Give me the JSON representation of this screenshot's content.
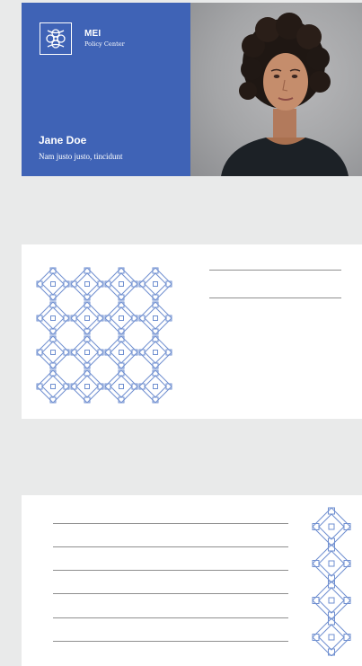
{
  "badge": {
    "brand_name": "MEI",
    "brand_subtitle": "Policy Center",
    "person_name": "Jane Doe",
    "person_title": "Nam justo justo, tincidunt"
  },
  "colors": {
    "background": "#e9eaea",
    "brand_blue": "#3f63b6",
    "pattern_blue": "#6f8fd0",
    "rule_gray": "#8f8f8f"
  }
}
